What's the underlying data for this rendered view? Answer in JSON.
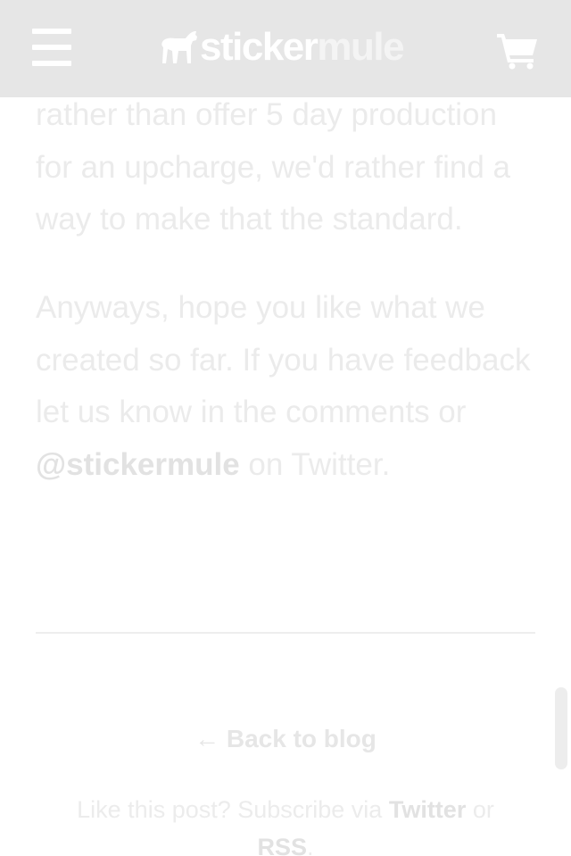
{
  "header": {
    "menu_icon": "hamburger-menu-icon",
    "logo": {
      "part1": "sticker",
      "part2": "mule",
      "icon": "mule-logo-icon"
    },
    "cart_icon": "shopping-cart-icon",
    "background": "#e6e6e6"
  },
  "article": {
    "paragraph1": "rather than offer 5 day production for an upcharge, we'd rather find a way to make that the standard.",
    "paragraph2": {
      "before": "Anyways, hope you like what we created so far. If you have feedback let us know in the comments or ",
      "link": "@stickermule",
      "after": " on Twitter."
    }
  },
  "footer": {
    "back_arrow": "←",
    "back_label": "Back to blog",
    "subscribe_prefix": "Like this post? Subscribe via ",
    "twitter_label": "Twitter",
    "or_text": " or ",
    "rss_label": "RSS",
    "period": "."
  },
  "colors": {
    "text": "#ebebeb",
    "link": "#e2e2e2",
    "divider": "#eeeeee"
  }
}
